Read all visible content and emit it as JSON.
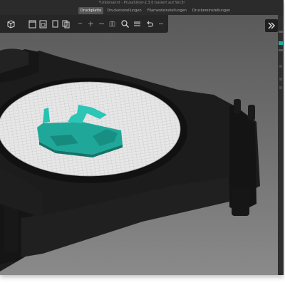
{
  "window": {
    "title": "*Unbenannt - PrusaSlicer-2.3.0 basiert auf Slic3r"
  },
  "tabs": [
    {
      "label": "Druckplatte",
      "active": true
    },
    {
      "label": "Druckeinstellungen",
      "active": false
    },
    {
      "label": "Filamenteinstellungen",
      "active": false
    },
    {
      "label": "Druckereinstellungen",
      "active": false
    }
  ],
  "toolbar": {
    "tools": [
      "add-object-icon",
      "delete-icon",
      "delete-all-icon",
      "arrange-icon",
      "copy-icon",
      "paste-icon",
      "add-instance-icon",
      "remove-instance-icon",
      "split-objects-icon",
      "split-parts-icon",
      "search-icon",
      "layer-editing-icon",
      "undo-icon",
      "redo-icon"
    ]
  },
  "colors": {
    "model": "#1fa899",
    "bed_surface": "#e7e7e7",
    "bed_grid": "#b9b9b9",
    "printer_frame": "#1c1c1c",
    "background_top": "#5a5a5a",
    "background_bottom": "#8a8a8a",
    "accent": "#1fb0a4"
  }
}
